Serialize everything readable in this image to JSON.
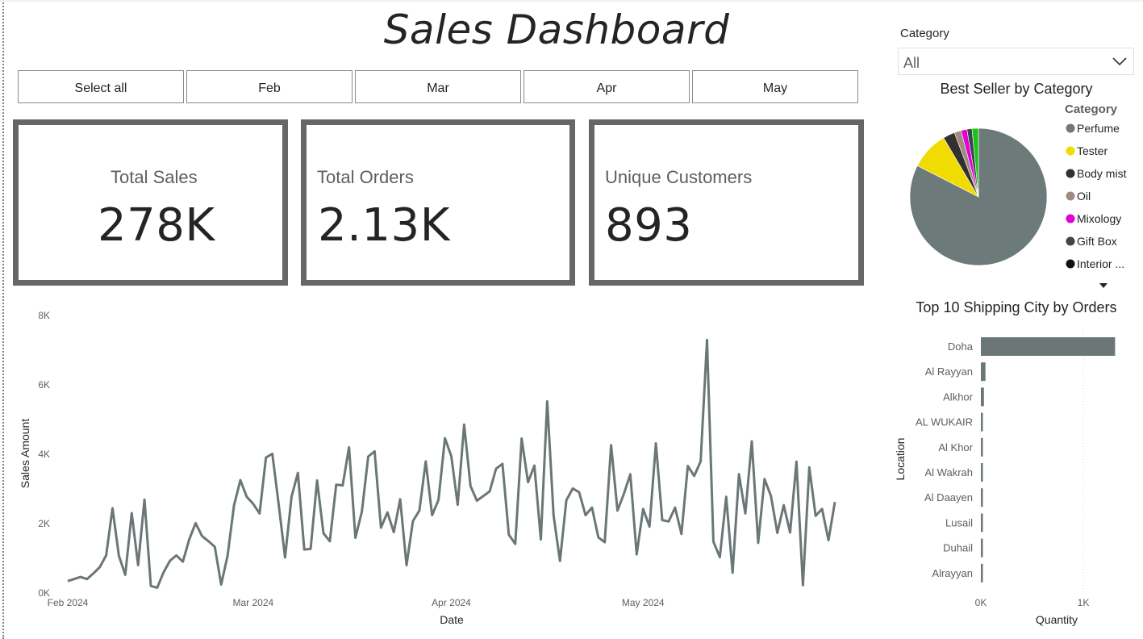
{
  "title": "Sales Dashboard",
  "month_slicer": [
    "Select all",
    "Feb",
    "Mar",
    "Apr",
    "May"
  ],
  "cards": [
    {
      "label": "Total Sales",
      "value": "278K"
    },
    {
      "label": "Total Orders",
      "value": "2.13K"
    },
    {
      "label": "Unique Customers",
      "value": "893"
    }
  ],
  "category_filter": {
    "label": "Category",
    "value": "All"
  },
  "pie": {
    "title": "Best Seller by Category",
    "legend_title": "Category",
    "legend": [
      {
        "label": "Perfume",
        "color": "#6c7a7a"
      },
      {
        "label": "Tester",
        "color": "#f0dc00"
      },
      {
        "label": "Body mist",
        "color": "#33302e"
      },
      {
        "label": "Oil",
        "color": "#a38a7e"
      },
      {
        "label": "Mixology",
        "color": "#e100d8"
      },
      {
        "label": "Gift Box",
        "color": "#3b4745"
      },
      {
        "label": "Interior ...",
        "color": "#111111"
      }
    ]
  },
  "bar": {
    "title": "Top 10 Shipping City by Orders",
    "ylabel": "Location",
    "xlabel": "Quantity",
    "xticks": [
      "0K",
      "1K"
    ]
  },
  "line": {
    "ylabel": "Sales Amount",
    "xlabel": "Date",
    "yticks": [
      "0K",
      "2K",
      "4K",
      "6K",
      "8K"
    ],
    "xticks": [
      "Feb 2024",
      "Mar 2024",
      "Apr 2024",
      "May 2024"
    ]
  },
  "chart_data": [
    {
      "type": "line",
      "title": "",
      "xlabel": "Date",
      "ylabel": "Sales Amount",
      "ylim": [
        0,
        8000
      ],
      "xlim": [
        "2024-02-01",
        "2024-05-31"
      ],
      "series": [
        {
          "color": "#6b7777",
          "values": [
            320,
            380,
            440,
            380,
            540,
            720,
            1060,
            2420,
            1050,
            500,
            2280,
            780,
            2670,
            180,
            130,
            580,
            910,
            1060,
            880,
            1520,
            1990,
            1620,
            1470,
            1310,
            220,
            1050,
            2500,
            3230,
            2750,
            2550,
            2270,
            3880,
            3990,
            2530,
            1000,
            2750,
            3440,
            1230,
            1250,
            3220,
            1700,
            1470,
            3100,
            3080,
            4180,
            1570,
            2320,
            3910,
            4060,
            1860,
            2300,
            1730,
            2680,
            780,
            2050,
            2350,
            3770,
            2220,
            2660,
            4440,
            3920,
            2520,
            4830,
            3060,
            2640,
            2770,
            2910,
            3560,
            3700,
            1660,
            1390,
            4430,
            3170,
            3650,
            1520,
            5500,
            2210,
            900,
            2650,
            2990,
            2880,
            2220,
            2440,
            1580,
            1440,
            4240,
            2350,
            2840,
            3400,
            1090,
            2400,
            1890,
            4290,
            2080,
            2040,
            2440,
            1680,
            3640,
            3350,
            3770,
            7270,
            1460,
            1010,
            2750,
            560,
            3400,
            2270,
            4350,
            1420,
            3260,
            2770,
            1710,
            2510,
            1720,
            3760,
            200,
            3600,
            2200,
            2400,
            1500,
            2600
          ]
        }
      ]
    },
    {
      "type": "pie",
      "title": "Best Seller by Category",
      "categories": [
        "Perfume",
        "Tester",
        "Body mist",
        "Oil",
        "Mixology",
        "Gift Box",
        "Interior ..."
      ],
      "values": [
        82.5,
        9.0,
        2.8,
        1.6,
        1.4,
        1.2,
        1.5
      ],
      "colors": [
        "#6c7a7a",
        "#f0dc00",
        "#33302e",
        "#a38a7e",
        "#e100d8",
        "#3b4745",
        "#1ec21e"
      ]
    },
    {
      "type": "bar",
      "title": "Top 10 Shipping City by Orders",
      "xlabel": "Quantity",
      "ylabel": "Location",
      "categories": [
        "Doha",
        "Al Rayyan",
        "Alkhor",
        "AL WUKAIR",
        "Al Khor",
        "Al Wakrah",
        "Al Daayen",
        "Lusail",
        "Duhail",
        "Alrayyan"
      ],
      "values": [
        1310,
        45,
        30,
        20,
        18,
        16,
        14,
        12,
        10,
        8
      ],
      "xlim": [
        0,
        1400
      ]
    }
  ]
}
